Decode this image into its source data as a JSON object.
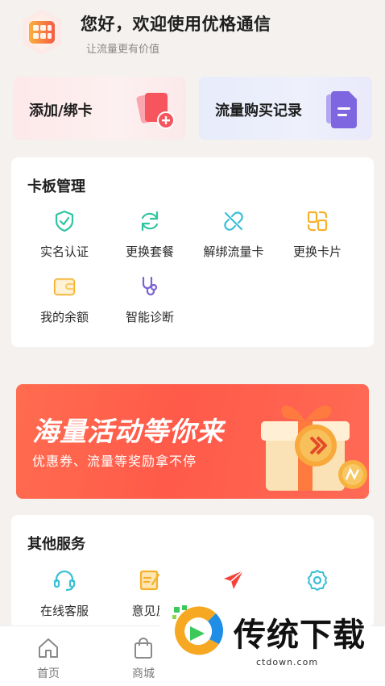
{
  "header": {
    "title": "您好，欢迎使用优格通信",
    "subtitle": "让流量更有价值"
  },
  "quick_cards": [
    {
      "label": "添加/绑卡",
      "icon": "add-card-icon"
    },
    {
      "label": "流量购买记录",
      "icon": "record-icon"
    }
  ],
  "card_management": {
    "title": "卡板管理",
    "items": [
      {
        "label": "实名认证",
        "icon": "shield-check-icon",
        "color": "#2fc4a2"
      },
      {
        "label": "更换套餐",
        "icon": "refresh-icon",
        "color": "#2fc4a2"
      },
      {
        "label": "解绑流量卡",
        "icon": "unlink-icon",
        "color": "#3bbfd6"
      },
      {
        "label": "更换卡片",
        "icon": "swap-card-icon",
        "color": "#f5b12c"
      },
      {
        "label": "我的余额",
        "icon": "wallet-icon",
        "color": "#f5b12c"
      },
      {
        "label": "智能诊断",
        "icon": "stethoscope-icon",
        "color": "#7b63d6"
      }
    ]
  },
  "banner": {
    "title": "海量活动等你来",
    "subtitle": "优惠券、流量等奖励拿不停",
    "bg_color": "#ff5a4a"
  },
  "other_services": {
    "title": "其他服务",
    "items": [
      {
        "label": "在线客服",
        "icon": "headset-icon",
        "color": "#3bbfd6"
      },
      {
        "label": "意见反",
        "icon": "feedback-icon",
        "color": "#f5b12c"
      },
      {
        "label": "",
        "icon": "paper-plane-icon",
        "color": "#f5433a"
      },
      {
        "label": "",
        "icon": "settings-icon",
        "color": "#3bbfd6"
      }
    ]
  },
  "tabbar": {
    "items": [
      {
        "label": "首页",
        "icon": "home-icon"
      },
      {
        "label": "商城",
        "icon": "shopping-bag-icon"
      }
    ]
  },
  "watermark": {
    "text": "传统下载",
    "url": "ctdown.com"
  }
}
